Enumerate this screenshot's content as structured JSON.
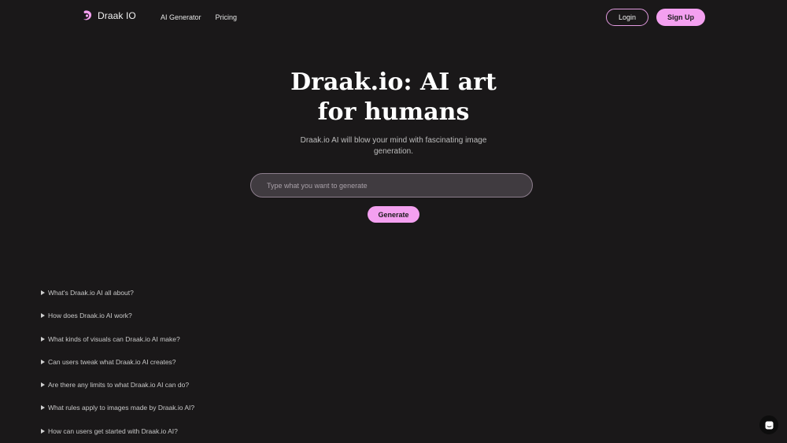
{
  "nav": {
    "brand": "Draak IO",
    "links": [
      "AI Generator",
      "Pricing"
    ],
    "login_label": "Login",
    "signup_label": "Sign Up"
  },
  "hero": {
    "title_line1": "Draak.io: AI art",
    "title_line2": "for humans",
    "subtitle": "Draak.io AI will blow your mind with fascinating image generation.",
    "prompt_placeholder": "Type what you want to generate",
    "prompt_value": "",
    "generate_label": "Generate"
  },
  "faq": [
    "What's Draak.io AI all about?",
    "How does Draak.io AI work?",
    "What kinds of visuals can Draak.io AI make?",
    "Can users tweak what Draak.io AI creates?",
    "Are there any limits to what Draak.io AI can do?",
    "What rules apply to images made by Draak.io AI?",
    "How can users get started with Draak.io AI?"
  ],
  "colors": {
    "background": "#1a1819",
    "accent": "#f4a0f0",
    "input_bg": "#403b40"
  },
  "icons": {
    "brand": "draak-logo-icon",
    "chat": "chat-icon",
    "faq": "triangle-right-icon"
  }
}
